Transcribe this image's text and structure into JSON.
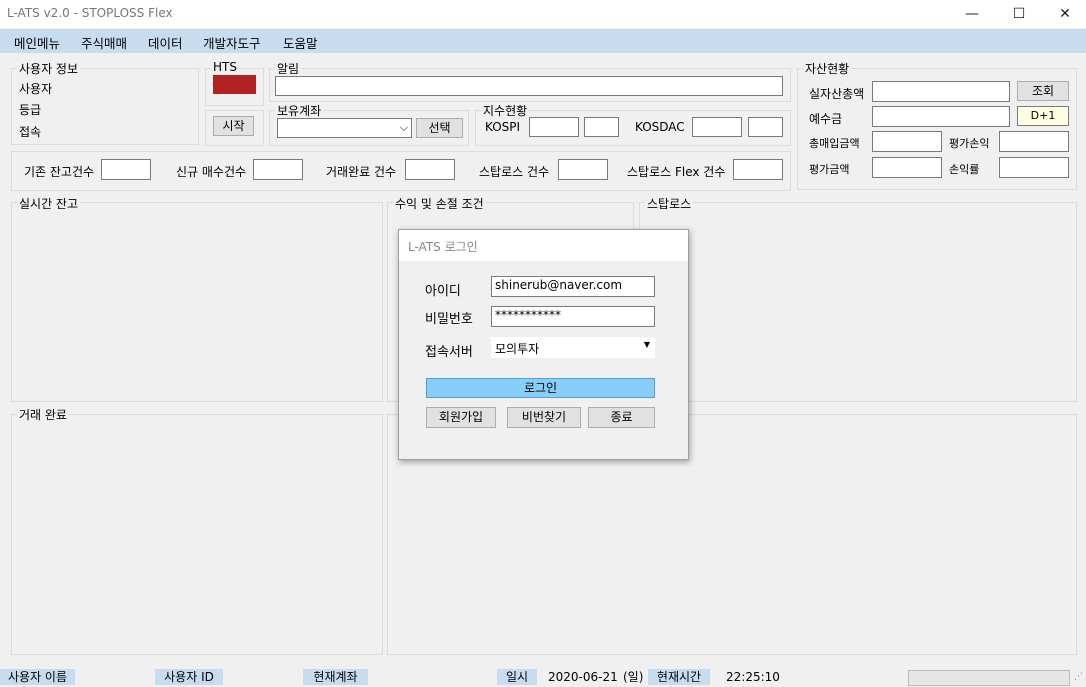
{
  "window": {
    "title": "L-ATS v2.0 - STOPLOSS Flex",
    "min": "—",
    "max": "☐",
    "close": "✕"
  },
  "menu": [
    "메인메뉴",
    "주식매매",
    "데이터",
    "개발자도구",
    "도움말"
  ],
  "user_info": {
    "group": "사용자 정보",
    "user": "사용자",
    "grade": "등급",
    "connect": "접속"
  },
  "hts": {
    "label": "HTS",
    "status_color": "#b22222",
    "start": "시작"
  },
  "notice": {
    "group": "알림"
  },
  "account": {
    "group": "보유계좌",
    "select": "선택"
  },
  "index": {
    "group": "지수현황",
    "kospi": "KOSPI",
    "kosdaq": "KOSDAC"
  },
  "counts": {
    "base": "기존 잔고건수",
    "new_buy": "신규 매수건수",
    "done": "거래완료 건수",
    "stoploss": "스탑로스 건수",
    "flex": "스탑로스 Flex 건수"
  },
  "assets": {
    "group": "자산현황",
    "total": "실자산총액",
    "deposit": "예수금",
    "buy_total": "총매입금액",
    "eval_pl": "평가손익",
    "eval_amt": "평가금액",
    "pl_rate": "손익률",
    "query": "조회",
    "d1": "D+1"
  },
  "panels": {
    "realtime": "실시간 잔고",
    "conditions": "수익 및 손절 조건",
    "stoploss": "스탑로스",
    "trade_done": "거래 완료"
  },
  "status": {
    "user_name": "사용자 이름",
    "user_id": "사용자 ID",
    "account": "현재계좌",
    "date_label": "일시",
    "date": "2020-06-21",
    "weekday": "(일)",
    "time_label": "현재시간",
    "time": "22:25:10"
  },
  "login": {
    "title": "L-ATS 로그인",
    "id_label": "아이디",
    "id_value": "shinerub@naver.com",
    "pw_label": "비밀번호",
    "pw_value": "***********",
    "server_label": "접속서버",
    "server_value": "모의투자",
    "login_btn": "로그인",
    "signup": "회원가입",
    "find_pw": "비번찾기",
    "exit": "종료"
  }
}
